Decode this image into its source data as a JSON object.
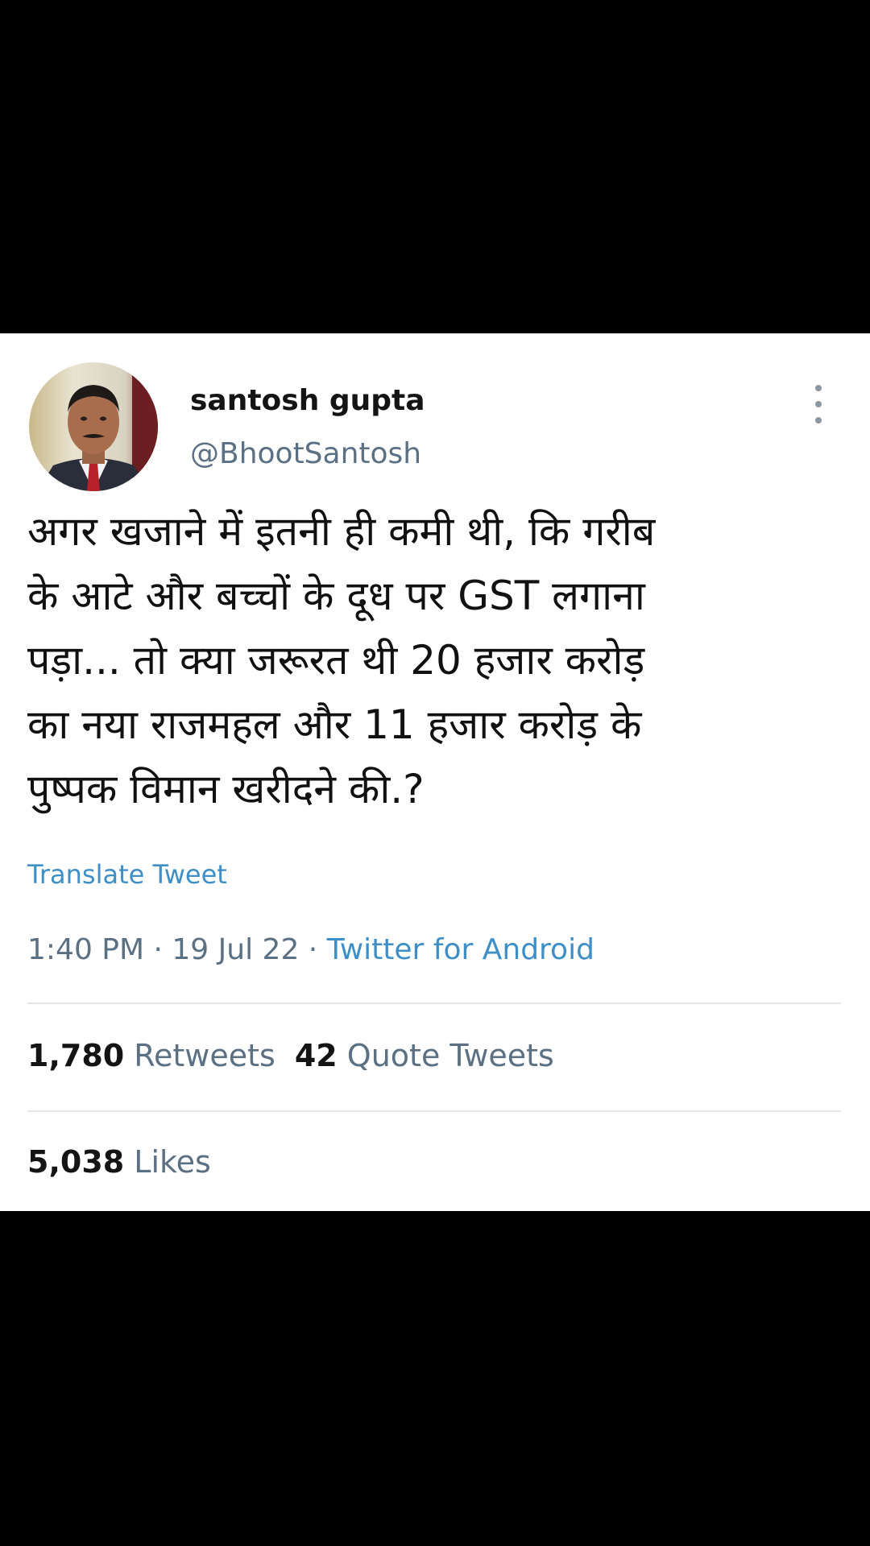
{
  "tweet": {
    "display_name": "santosh gupta",
    "handle": "@BhootSantosh",
    "text": "अगर खजाने में इतनी ही कमी थी, कि गरीब\nके आटे और बच्चों के दूध पर GST लगाना\nपड़ा... तो क्या जरूरत थी 20 हजार करोड़\nका नया राजमहल और 11 हजार करोड़ के\nपुष्पक विमान खरीदने की.?",
    "translate_label": "Translate Tweet",
    "time": "1:40 PM",
    "separator": " · ",
    "date": "19 Jul 22",
    "source": "Twitter for Android",
    "retweets_count": "1,780",
    "retweets_label": "Retweets",
    "quotes_count": "42",
    "quotes_label": "Quote Tweets",
    "likes_count": "5,038",
    "likes_label": "Likes"
  },
  "icons": {
    "avatar": "avatar-photo",
    "more": "more-options-icon"
  },
  "colors": {
    "link_blue": "#3f8fc7",
    "secondary_gray": "#5b7083",
    "text_dark": "#141414",
    "background": "#ffffff",
    "frame": "#000000"
  }
}
